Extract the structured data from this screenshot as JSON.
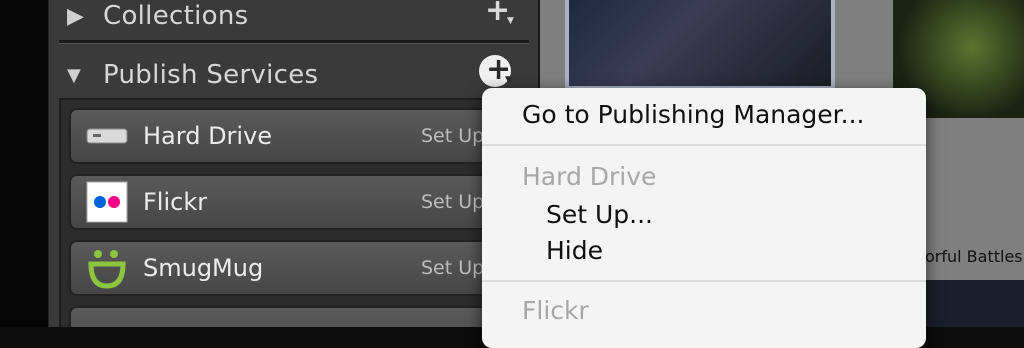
{
  "sections": {
    "collections": {
      "title": "Collections"
    },
    "publish_services": {
      "title": "Publish Services"
    }
  },
  "services": [
    {
      "name": "Hard Drive",
      "action": "Set Up",
      "icon": "hard-drive-icon"
    },
    {
      "name": "Flickr",
      "action": "Set Up",
      "icon": "flickr-icon"
    },
    {
      "name": "SmugMug",
      "action": "Set Up",
      "icon": "smugmug-icon"
    }
  ],
  "menu": {
    "go_to_manager": "Go to Publishing Manager...",
    "group1_heading": "Hard Drive",
    "group1_setup": "Set Up...",
    "group1_hide": "Hide",
    "group2_heading": "Flickr"
  },
  "grid": {
    "caption": "orful Battles"
  },
  "colors": {
    "panel": "#3a3a3a",
    "menu": "#f4f4f4",
    "flickr_blue": "#0063dc",
    "flickr_pink": "#ff0084",
    "smugmug_green": "#8cc63f"
  }
}
